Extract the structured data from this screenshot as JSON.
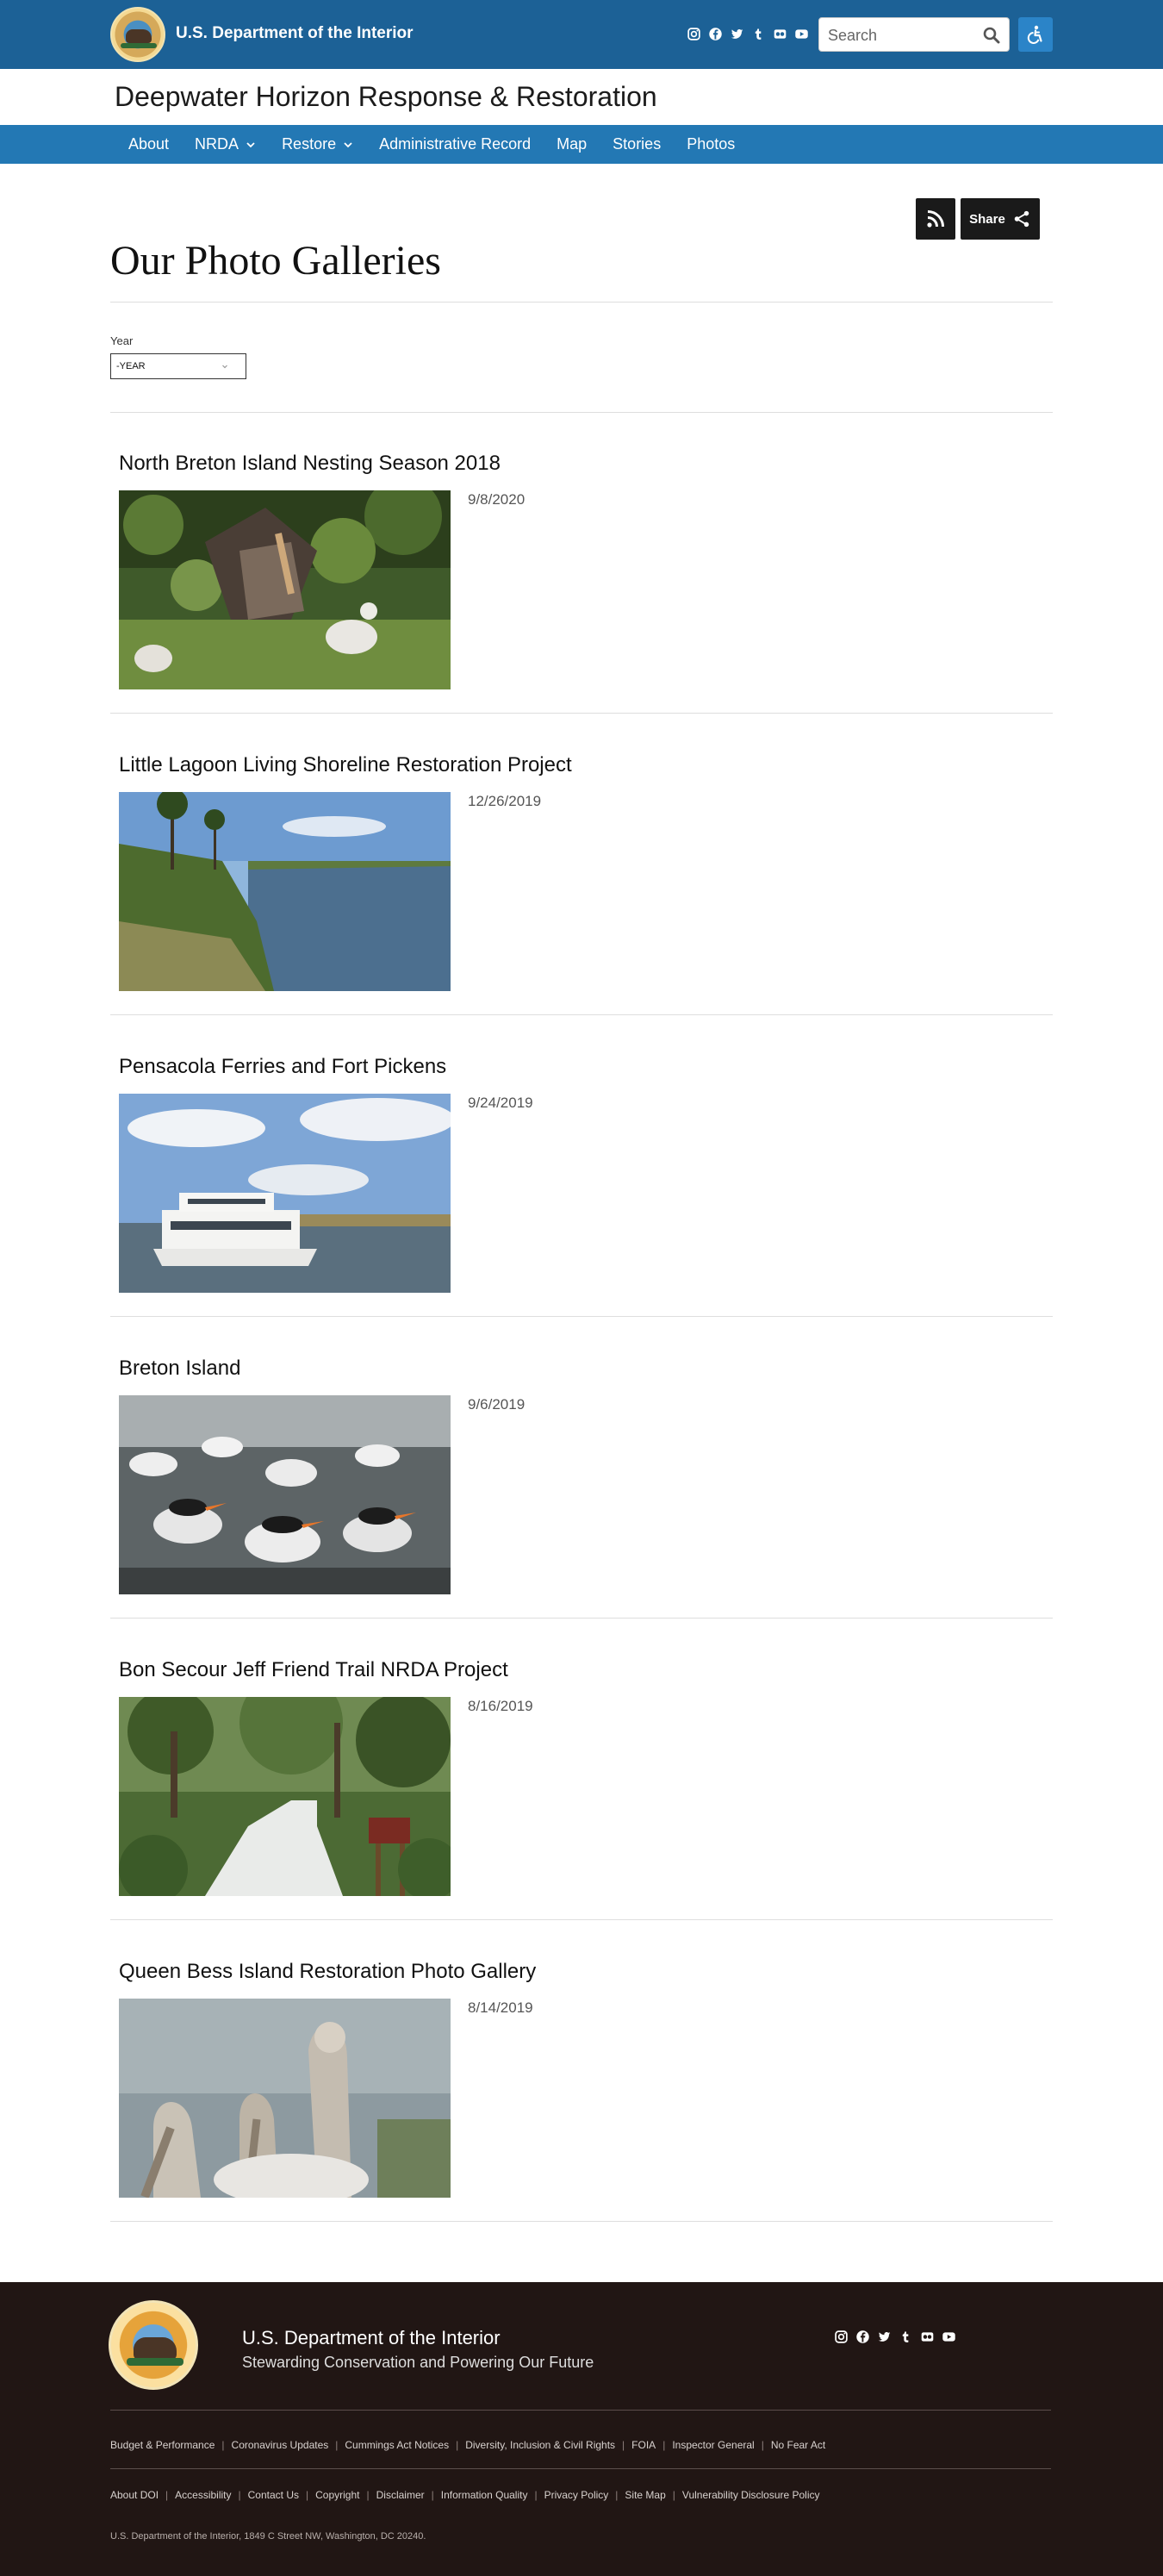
{
  "header": {
    "agency": "U.S. Department of the Interior",
    "social_icons": [
      "instagram-icon",
      "facebook-icon",
      "twitter-icon",
      "tumblr-icon",
      "flickr-icon",
      "youtube-icon"
    ],
    "search_placeholder": "Search",
    "colors": {
      "top_bar": "#1c6196",
      "nav_bar": "#2378b4"
    }
  },
  "site": {
    "title": "Deepwater Horizon Response & Restoration"
  },
  "nav": {
    "items": [
      {
        "label": "About",
        "dropdown": false
      },
      {
        "label": "NRDA",
        "dropdown": true
      },
      {
        "label": "Restore",
        "dropdown": true
      },
      {
        "label": "Administrative Record",
        "dropdown": false
      },
      {
        "label": "Map",
        "dropdown": false
      },
      {
        "label": "Stories",
        "dropdown": false
      },
      {
        "label": "Photos",
        "dropdown": false
      }
    ]
  },
  "page": {
    "title": "Our Photo Galleries",
    "share_label": "Share",
    "filter": {
      "label": "Year",
      "selected": "-YEAR"
    }
  },
  "galleries": [
    {
      "title": "North Breton Island Nesting Season 2018",
      "date": "9/8/2020",
      "image": "pelicans-nesting"
    },
    {
      "title": "Little Lagoon Living Shoreline Restoration Project",
      "date": "12/26/2019",
      "image": "lagoon-shoreline"
    },
    {
      "title": "Pensacola Ferries and Fort Pickens",
      "date": "9/24/2019",
      "image": "ferry-boat"
    },
    {
      "title": "Breton Island",
      "date": "9/6/2019",
      "image": "tern-colony"
    },
    {
      "title": "Bon Secour Jeff Friend Trail NRDA Project",
      "date": "8/16/2019",
      "image": "forest-trail"
    },
    {
      "title": "Queen Bess Island Restoration Photo Gallery",
      "date": "8/14/2019",
      "image": "brown-pelicans"
    }
  ],
  "footer": {
    "agency": "U.S. Department of the Interior",
    "tagline": "Stewarding Conservation and Powering Our Future",
    "links_row1": [
      "Budget & Performance",
      "Coronavirus Updates",
      "Cummings Act Notices",
      "Diversity, Inclusion & Civil Rights",
      "FOIA",
      "Inspector General",
      "No Fear Act"
    ],
    "links_row2": [
      "About DOI",
      "Accessibility",
      "Contact Us",
      "Copyright",
      "Disclaimer",
      "Information Quality",
      "Privacy Policy",
      "Site Map",
      "Vulnerability Disclosure Policy"
    ],
    "address": "U.S. Department of the Interior, 1849 C Street NW, Washington, DC 20240.",
    "colors": {
      "background": "#211614"
    }
  }
}
